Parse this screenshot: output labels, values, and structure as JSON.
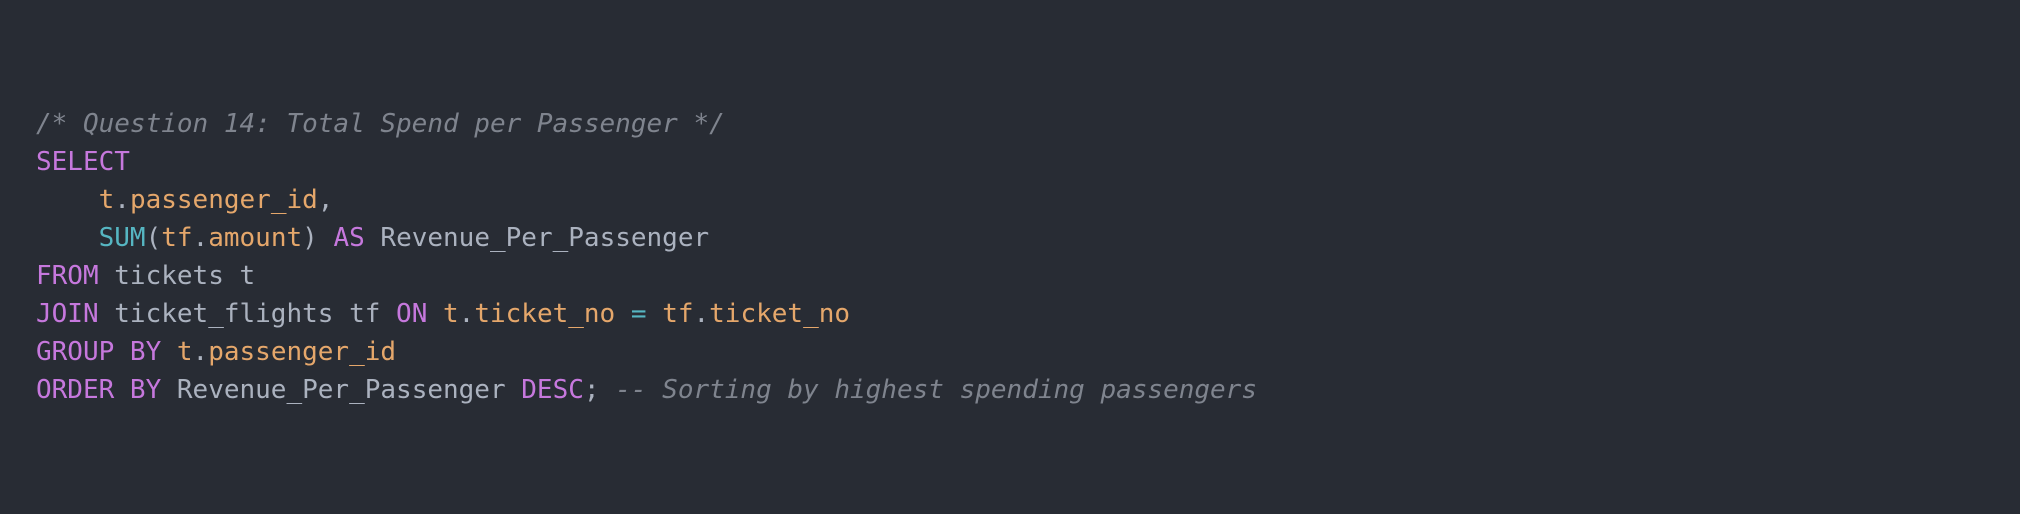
{
  "colors": {
    "background": "#282c34",
    "plain": "#abb2bf",
    "comment": "#7f848e",
    "keyword": "#c678dd",
    "function": "#56b6c2",
    "identifier": "#e5a76b"
  },
  "code": {
    "lines": [
      {
        "tokens": [
          {
            "t": "/* Question 14: Total Spend per Passenger */",
            "k": "comment"
          }
        ]
      },
      {
        "tokens": [
          {
            "t": "SELECT",
            "k": "keyword"
          }
        ]
      },
      {
        "tokens": [
          {
            "t": "    ",
            "k": "plain"
          },
          {
            "t": "t",
            "k": "property"
          },
          {
            "t": ".",
            "k": "plain"
          },
          {
            "t": "passenger_id",
            "k": "property"
          },
          {
            "t": ",",
            "k": "plain"
          }
        ]
      },
      {
        "tokens": [
          {
            "t": "    ",
            "k": "plain"
          },
          {
            "t": "SUM",
            "k": "function"
          },
          {
            "t": "(",
            "k": "plain"
          },
          {
            "t": "tf",
            "k": "property"
          },
          {
            "t": ".",
            "k": "plain"
          },
          {
            "t": "amount",
            "k": "property"
          },
          {
            "t": ") ",
            "k": "plain"
          },
          {
            "t": "AS",
            "k": "keyword"
          },
          {
            "t": " Revenue_Per_Passenger",
            "k": "plain"
          }
        ]
      },
      {
        "tokens": [
          {
            "t": "FROM",
            "k": "keyword"
          },
          {
            "t": " tickets t",
            "k": "plain"
          }
        ]
      },
      {
        "tokens": [
          {
            "t": "JOIN",
            "k": "keyword"
          },
          {
            "t": " ticket_flights tf ",
            "k": "plain"
          },
          {
            "t": "ON",
            "k": "keyword"
          },
          {
            "t": " ",
            "k": "plain"
          },
          {
            "t": "t",
            "k": "property"
          },
          {
            "t": ".",
            "k": "plain"
          },
          {
            "t": "ticket_no",
            "k": "property"
          },
          {
            "t": " ",
            "k": "plain"
          },
          {
            "t": "=",
            "k": "operator"
          },
          {
            "t": " ",
            "k": "plain"
          },
          {
            "t": "tf",
            "k": "property"
          },
          {
            "t": ".",
            "k": "plain"
          },
          {
            "t": "ticket_no",
            "k": "property"
          }
        ]
      },
      {
        "tokens": [
          {
            "t": "GROUP BY",
            "k": "keyword"
          },
          {
            "t": " ",
            "k": "plain"
          },
          {
            "t": "t",
            "k": "property"
          },
          {
            "t": ".",
            "k": "plain"
          },
          {
            "t": "passenger_id",
            "k": "property"
          }
        ]
      },
      {
        "tokens": [
          {
            "t": "ORDER BY",
            "k": "keyword"
          },
          {
            "t": " Revenue_Per_Passenger ",
            "k": "plain"
          },
          {
            "t": "DESC",
            "k": "keyword"
          },
          {
            "t": "; ",
            "k": "plain"
          },
          {
            "t": "-- Sorting by highest spending passengers",
            "k": "comment"
          }
        ]
      }
    ]
  }
}
